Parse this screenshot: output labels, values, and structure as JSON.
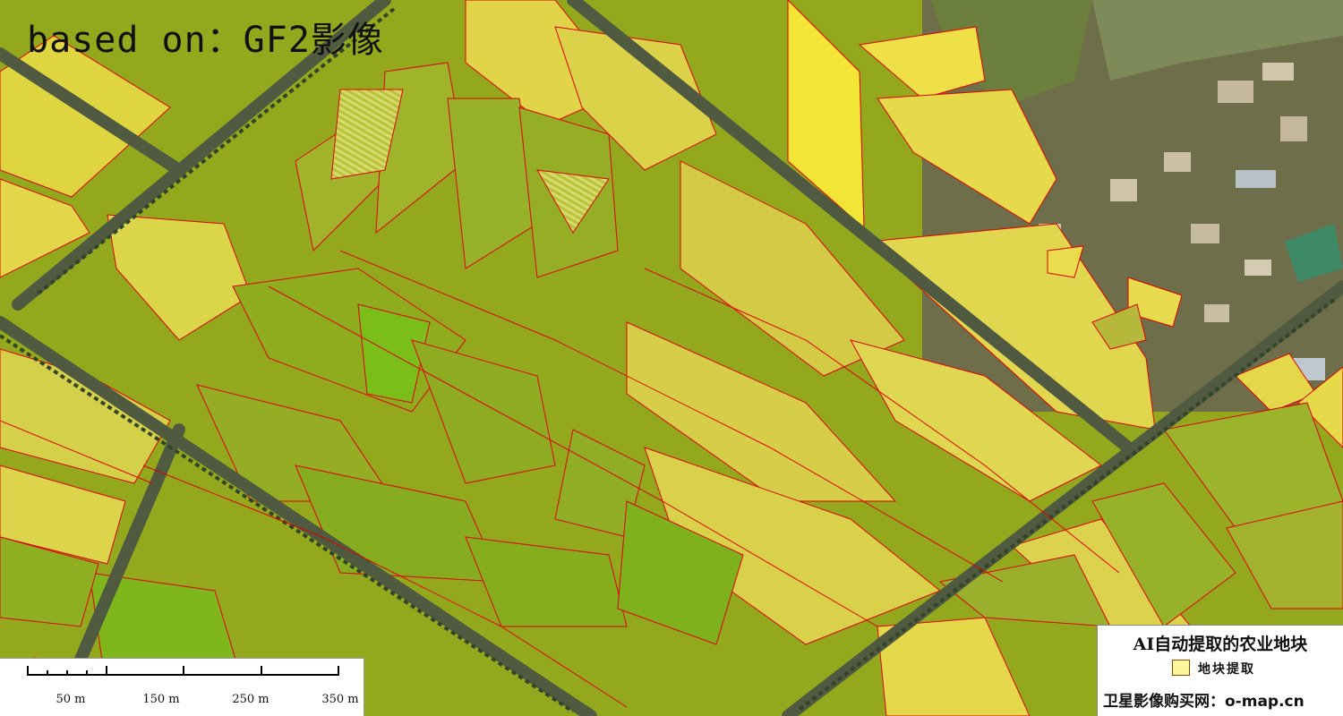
{
  "overlay": {
    "title": "based on：GF2影像"
  },
  "legend": {
    "title": "AI自动提取的农业地块",
    "items": [
      {
        "label": "地块提取",
        "fill": "#fdf59a",
        "outline": "#d40000"
      }
    ],
    "site": "卫星影像购买网：o-map.cn"
  },
  "scalebar": {
    "labels": [
      "50 m",
      "150 m",
      "250 m",
      "350 m"
    ]
  },
  "colors": {
    "field_boundary": "#e00000",
    "yellow_field": "#ddd13a",
    "green_field": "#8eaa14",
    "road": "#4d5440",
    "village": "#9b7f5d"
  }
}
